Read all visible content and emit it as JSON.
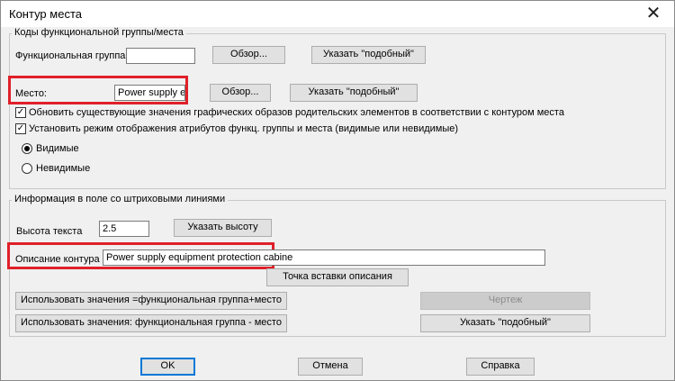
{
  "window": {
    "title": "Контур места",
    "close_glyph": "✕"
  },
  "codes_group": {
    "title": "Коды функциональной группы/места",
    "func_group_label": "Функциональная группа:",
    "func_group_value": "",
    "browse_label": "Обзор...",
    "similar_label": "Указать \"подобный\"",
    "place_label": "Место:",
    "place_value": "Power supply equ",
    "place_browse_label": "Обзор...",
    "place_similar_label": "Указать \"подобный\"",
    "update_checkbox_label": "Обновить существующие значения графических образов родительских элементов в соответствии с контуром места",
    "update_checked": true,
    "display_mode_checkbox_label": "Установить режим отображения атрибутов функц. группы и места (видимые или невидимые)",
    "display_mode_checked": true,
    "radio_visible_label": "Видимые",
    "radio_invisible_label": "Невидимые",
    "selected_radio": "visible",
    "checkmark_glyph": "✓"
  },
  "info_group": {
    "title": "Информация в поле со штриховыми линиями",
    "text_height_label": "Высота текста",
    "text_height_value": "2.5",
    "set_height_label": "Указать высоту",
    "contour_desc_label": "Описание контура",
    "contour_desc_value": "Power supply equipment protection cabine",
    "insert_point_label": "Точка вставки описания",
    "use_plus_label": "Использовать значения =функциональная группа+место",
    "drawing_label": "Чертеж",
    "use_minus_label": "Использовать значения: функциональная группа - место",
    "similar_label": "Указать \"подобный\""
  },
  "footer": {
    "ok_label": "OK",
    "cancel_label": "Отмена",
    "help_label": "Справка"
  },
  "colors": {
    "highlight_red": "#e0202a",
    "focus_blue": "#0078d7"
  }
}
